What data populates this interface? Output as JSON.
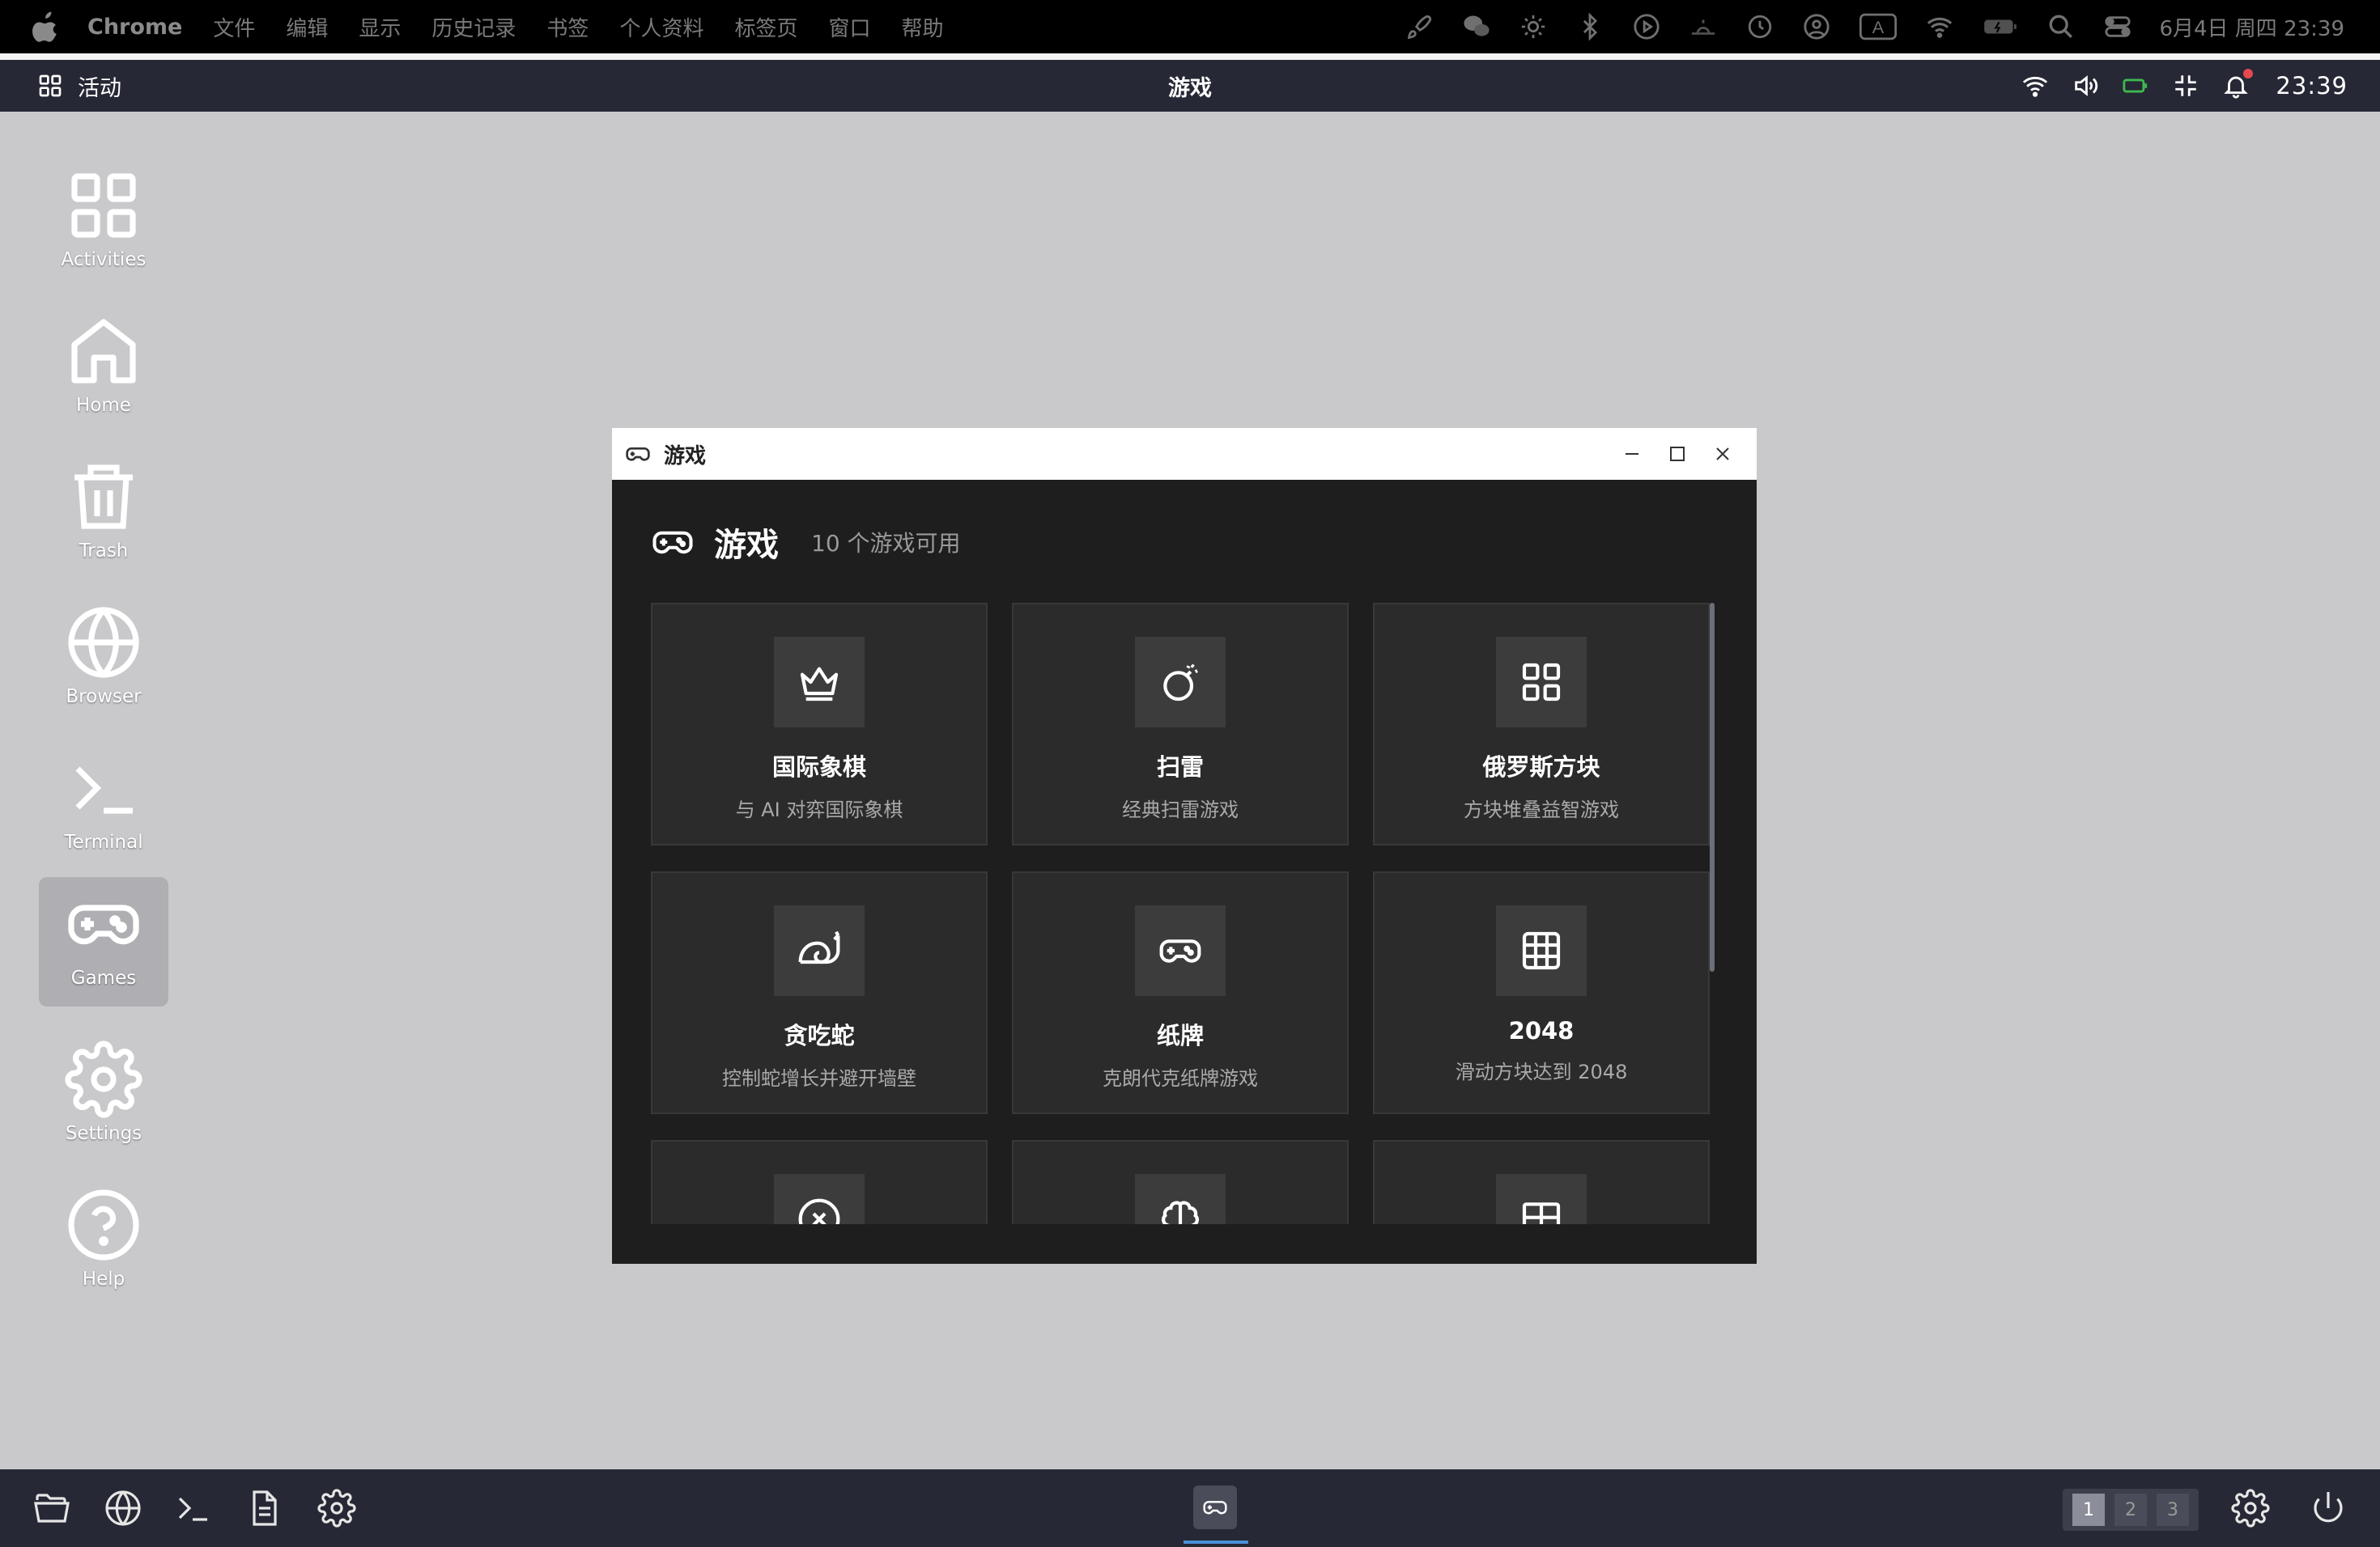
{
  "mac_menubar": {
    "app_name": "Chrome",
    "menus": [
      "文件",
      "编辑",
      "显示",
      "历史记录",
      "书签",
      "个人资料",
      "标签页",
      "窗口",
      "帮助"
    ],
    "status_icons": [
      "rocket-icon",
      "wechat-icon",
      "sun-icon",
      "bluetooth-icon",
      "play-icon",
      "sunrise-icon",
      "clock-icon",
      "user-icon",
      "input-a-icon",
      "wifi-icon",
      "battery-icon",
      "search-icon",
      "control-center-icon"
    ],
    "input_label": "A",
    "datetime": "6月4日 周四  23:39"
  },
  "top_panel": {
    "activities_label": "活动",
    "title": "游戏",
    "time": "23:39",
    "icons": [
      "wifi-icon",
      "volume-icon",
      "battery-icon",
      "collapse-icon",
      "bell-icon"
    ]
  },
  "desktop_icons": [
    {
      "label": "Activities",
      "icon": "grid-icon"
    },
    {
      "label": "Home",
      "icon": "home-icon"
    },
    {
      "label": "Trash",
      "icon": "trash-icon"
    },
    {
      "label": "Browser",
      "icon": "globe-icon"
    },
    {
      "label": "Terminal",
      "icon": "terminal-icon"
    },
    {
      "label": "Games",
      "icon": "gamepad-icon",
      "selected": true
    },
    {
      "label": "Settings",
      "icon": "gear-icon"
    },
    {
      "label": "Help",
      "icon": "help-icon"
    }
  ],
  "window": {
    "title": "游戏",
    "header_title": "游戏",
    "header_subtitle": "10 个游戏可用",
    "games": [
      {
        "name": "国际象棋",
        "desc": "与 AI 对弈国际象棋",
        "icon": "crown-icon"
      },
      {
        "name": "扫雷",
        "desc": "经典扫雷游戏",
        "icon": "bomb-icon"
      },
      {
        "name": "俄罗斯方块",
        "desc": "方块堆叠益智游戏",
        "icon": "blocks-icon"
      },
      {
        "name": "贪吃蛇",
        "desc": "控制蛇增长并避开墙壁",
        "icon": "snail-icon"
      },
      {
        "name": "纸牌",
        "desc": "克朗代克纸牌游戏",
        "icon": "gamepad-icon"
      },
      {
        "name": "2048",
        "desc": "滑动方块达到 2048",
        "icon": "grid-3x3-icon"
      },
      {
        "name": "",
        "desc": "",
        "icon": "circle-x-icon"
      },
      {
        "name": "",
        "desc": "",
        "icon": "brain-icon"
      },
      {
        "name": "",
        "desc": "",
        "icon": "book-icon"
      }
    ]
  },
  "dock": {
    "left_icons": [
      "folder-icon",
      "globe-icon",
      "terminal-icon",
      "document-icon",
      "gear-icon"
    ],
    "active_app_icon": "gamepad-icon",
    "workspaces": [
      "1",
      "2",
      "3"
    ],
    "active_workspace": "1",
    "right_icons": [
      "gear-icon",
      "power-icon"
    ]
  }
}
